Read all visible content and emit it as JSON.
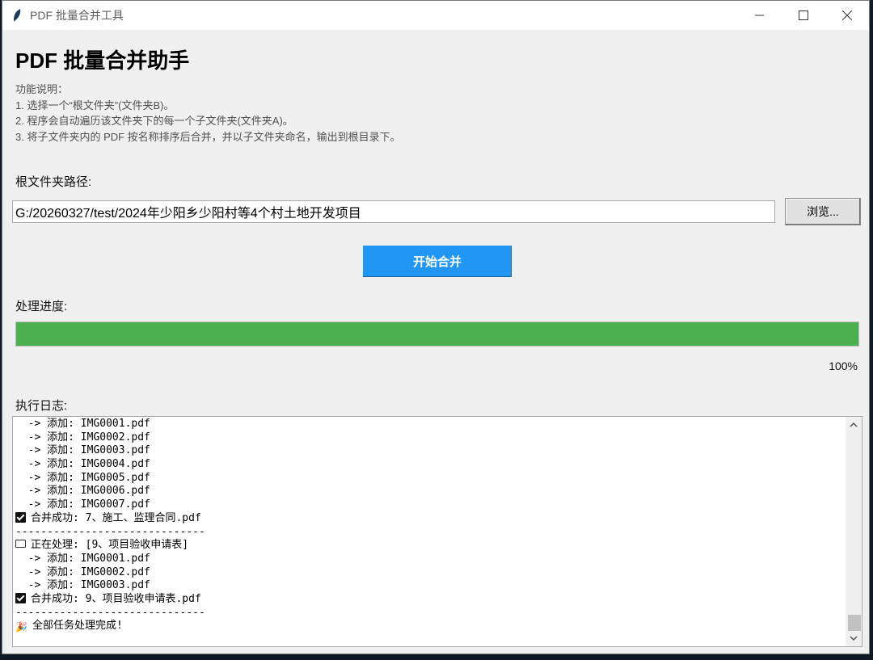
{
  "window": {
    "title": "PDF 批量合并工具"
  },
  "heading": "PDF 批量合并助手",
  "description": [
    "功能说明：",
    "1. 选择一个“根文件夹”(文件夹B)。",
    "2. 程序会自动遍历该文件夹下的每一个子文件夹(文件夹A)。",
    "3. 将子文件夹内的 PDF 按名称排序后合并，并以子文件夹命名，输出到根目录下。"
  ],
  "root_path": {
    "label": "根文件夹路径:",
    "value": "G:/20260327/test/2024年少阳乡少阳村等4个村土地开发项目"
  },
  "browse_label": "浏览...",
  "start_label": "开始合并",
  "progress": {
    "label": "处理进度:",
    "value": 1.0,
    "percent_text": "100%",
    "color": "#4caf50"
  },
  "log": {
    "label": "执行日志:",
    "lines": [
      {
        "icon": "",
        "text": "  -> 添加: IMG0001.pdf"
      },
      {
        "icon": "",
        "text": "  -> 添加: IMG0002.pdf"
      },
      {
        "icon": "",
        "text": "  -> 添加: IMG0003.pdf"
      },
      {
        "icon": "",
        "text": "  -> 添加: IMG0004.pdf"
      },
      {
        "icon": "",
        "text": "  -> 添加: IMG0005.pdf"
      },
      {
        "icon": "",
        "text": "  -> 添加: IMG0006.pdf"
      },
      {
        "icon": "",
        "text": "  -> 添加: IMG0007.pdf"
      },
      {
        "icon": "check",
        "text": "合并成功: 7、施工、监理合同.pdf"
      },
      {
        "icon": "",
        "text": "------------------------------"
      },
      {
        "icon": "folder",
        "text": "正在处理: [9、项目验收申请表]"
      },
      {
        "icon": "",
        "text": "  -> 添加: IMG0001.pdf"
      },
      {
        "icon": "",
        "text": "  -> 添加: IMG0002.pdf"
      },
      {
        "icon": "",
        "text": "  -> 添加: IMG0003.pdf"
      },
      {
        "icon": "check",
        "text": "合并成功: 9、项目验收申请表.pdf"
      },
      {
        "icon": "",
        "text": "------------------------------"
      },
      {
        "icon": "party",
        "text": "全部任务处理完成!"
      }
    ]
  },
  "colors": {
    "start_button": "#2196f3",
    "progress_fill": "#4caf50"
  }
}
